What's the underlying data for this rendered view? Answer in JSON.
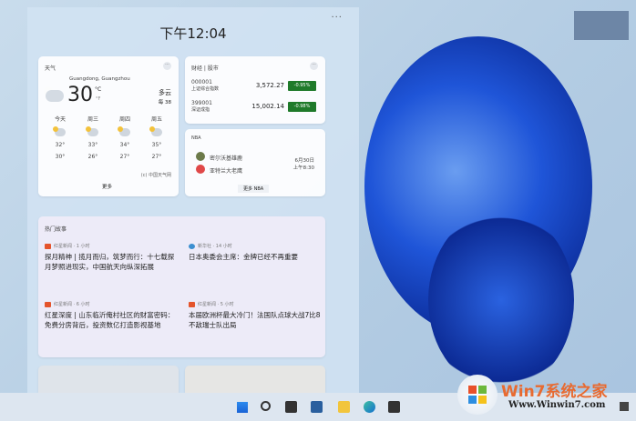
{
  "panel": {
    "time": "下午12:04",
    "more": "···"
  },
  "weather": {
    "title": "天气",
    "location": "Guangdong, Guangzhou",
    "temp": "30",
    "unit_c": "°C",
    "unit_f": "°F",
    "condition": "多云",
    "aqi": "每 38",
    "forecast": [
      {
        "day": "今天",
        "high": "32°",
        "low": "30°"
      },
      {
        "day": "周三",
        "high": "33°",
        "low": "26°"
      },
      {
        "day": "周四",
        "high": "34°",
        "low": "27°"
      },
      {
        "day": "周五",
        "high": "35°",
        "low": "27°"
      }
    ],
    "source": "(c) 中国天气网",
    "more": "更多"
  },
  "finance": {
    "title": "财经 | 股市",
    "stocks": [
      {
        "code": "000001",
        "name": "上证综合指数",
        "price": "3,572.27",
        "change": "-0.95%"
      },
      {
        "code": "399001",
        "name": "深证成指",
        "price": "15,002.14",
        "change": "-0.98%"
      }
    ],
    "up_color": "#1f7a2a"
  },
  "nba": {
    "title": "NBA",
    "team1": "密尔沃基雄鹿",
    "team2": "亚特兰大老鹰",
    "date": "6月30日",
    "time": "上午8:30",
    "more": "更多 NBA"
  },
  "stories": {
    "title": "热门故事",
    "items": [
      {
        "source": "红星新闻 · 1 小时",
        "headline": "探月精神 | 揽月而归，筑梦而行：十七载探月梦照进现实，中国航天向纵深拓展"
      },
      {
        "source": "新华社 · 14 小时",
        "headline": "日本奥委会主席：金牌已经不再重要"
      },
      {
        "source": "红星新闻 · 6 小时",
        "headline": "红星深度 | 山东临沂俺村社区的财富密码：免费分房背后，投资数亿打造影视基地"
      },
      {
        "source": "红星新闻 · 5 小时",
        "headline": "本届欧洲杯最大冷门！法国队点球大战7比8不敌瑞士队出局"
      }
    ]
  },
  "watermark": {
    "brand": "Win7系统之家",
    "url": "Www.Winwin7.com"
  },
  "taskbar": {
    "icons": [
      "windows-start",
      "search",
      "task-view",
      "widgets",
      "file-explorer",
      "edge",
      "store"
    ]
  }
}
